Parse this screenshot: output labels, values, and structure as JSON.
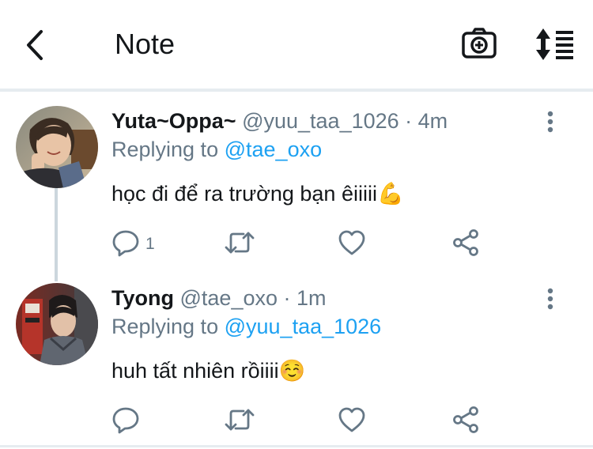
{
  "header": {
    "title": "Note",
    "back_icon": "chevron-left-icon",
    "camera_icon": "camera-plus-icon",
    "sort_icon": "sort-list-icon"
  },
  "colors": {
    "accent": "#1da1f2",
    "secondary_text": "#657786",
    "primary_text": "#14171a",
    "divider": "#e6ecf0"
  },
  "tweets": [
    {
      "name": "Yuta~Oppa~",
      "handle": "@yuu_taa_1026",
      "time": "· 4m",
      "replying_prefix": "Replying to",
      "replying_to": "@tae_oxo",
      "text": "học đi để ra trường bạn êiiiii💪",
      "reply_count": "1"
    },
    {
      "name": "Tyong",
      "handle": "@tae_oxo",
      "time": "· 1m",
      "replying_prefix": "Replying to",
      "replying_to": "@yuu_taa_1026",
      "text": "huh tất nhiên rồiiii☺️",
      "reply_count": ""
    }
  ],
  "actions": {
    "reply_icon": "reply-icon",
    "retweet_icon": "retweet-icon",
    "like_icon": "heart-icon",
    "share_icon": "share-icon",
    "more_icon": "more-vertical-icon"
  }
}
